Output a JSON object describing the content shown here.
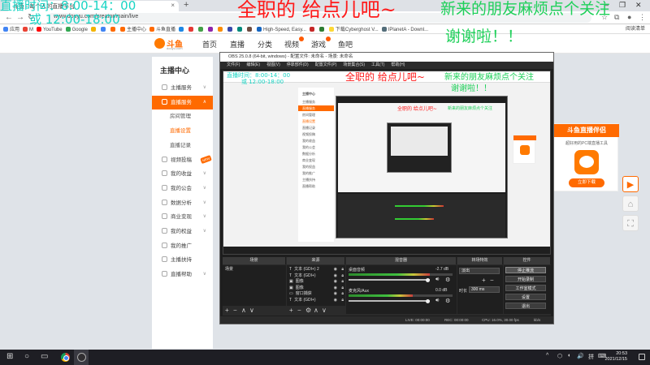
{
  "browser": {
    "tab_title": "斗鱼 - 每个人的直播平台",
    "new_tab": "+",
    "window_controls": [
      "–",
      "❐",
      "✕"
    ],
    "url": "www.douyu.com/creator/main/live",
    "bookmarks": [
      {
        "label": "应用",
        "color": "#4285f4"
      },
      {
        "label": "M",
        "color": "#ea4335"
      },
      {
        "label": "YouTube",
        "color": "#ff0000"
      },
      {
        "label": "Google",
        "color": "#34a853"
      },
      {
        "label": "",
        "color": "#f4b400"
      },
      {
        "label": "",
        "color": "#4285f4"
      },
      {
        "label": "",
        "color": "#ff6a00"
      },
      {
        "label": "主播中心",
        "color": "#ff6a00"
      },
      {
        "label": "斗鱼直播",
        "color": "#ff6a00"
      },
      {
        "label": "",
        "color": "#1e88e5"
      },
      {
        "label": "",
        "color": "#e53935"
      },
      {
        "label": "",
        "color": "#43a047"
      },
      {
        "label": "",
        "color": "#8e24aa"
      },
      {
        "label": "",
        "color": "#fb8c00"
      },
      {
        "label": "",
        "color": "#3949ab"
      },
      {
        "label": "",
        "color": "#00897b"
      },
      {
        "label": "",
        "color": "#6d4c41"
      },
      {
        "label": "High-Speed, Easy...",
        "color": "#1565c0"
      },
      {
        "label": "",
        "color": "#c62828"
      },
      {
        "label": "",
        "color": "#2e7d32"
      },
      {
        "label": "下载Cyberghost V...",
        "color": "#fdd835"
      },
      {
        "label": "IPlanetA - Downl...",
        "color": "#546e7a"
      }
    ],
    "bookmarks_right": "阅读清单"
  },
  "site": {
    "logo_text": "斗鱼",
    "logo_sub": "douyu.com",
    "nav": [
      "首页",
      "直播",
      "分类",
      "视频",
      "游戏",
      "鱼吧"
    ],
    "hot_dot_color": "#ff5a00",
    "accent": "#ff6a00"
  },
  "sidebar": {
    "title": "主播中心",
    "items": [
      {
        "label": "主播服务",
        "arrow": "∨"
      },
      {
        "label": "直播服务",
        "arrow": "∧",
        "active": true
      },
      {
        "label": "房间管理",
        "sub": true
      },
      {
        "label": "直播设置",
        "sub": true,
        "active": true
      },
      {
        "label": "直播记录",
        "sub": true
      },
      {
        "label": "视频投稿",
        "arrow": "",
        "badge": "NEW"
      },
      {
        "label": "我的收益",
        "arrow": "∨"
      },
      {
        "label": "我的公会",
        "arrow": "∨"
      },
      {
        "label": "数据分析",
        "arrow": "∨"
      },
      {
        "label": "商业变现",
        "arrow": "∨"
      },
      {
        "label": "我的权益",
        "arrow": "∨"
      },
      {
        "label": "我的推广",
        "arrow": ""
      },
      {
        "label": "主播扶持",
        "arrow": ""
      },
      {
        "label": "直播帮助",
        "arrow": "∨"
      }
    ]
  },
  "ad": {
    "title": "斗鱼直播伴侣",
    "text": "超好用的PC端直播工具",
    "button": "立即下载"
  },
  "float_buttons": [
    "▶",
    "⌂",
    "⛶"
  ],
  "obs": {
    "title": "OBS 25.0.8 (64-bit, windows) - 配置文件: 未命名 - 场景: 未命名",
    "menu": [
      "文件(F)",
      "编辑(E)",
      "视图(V)",
      "停靠部件(D)",
      "配置文件(P)",
      "场景集合(S)",
      "工具(T)",
      "帮助(H)"
    ],
    "docks": {
      "scenes": "场景",
      "sources": "来源",
      "mixer": "混音器",
      "transitions": "转场特效",
      "controls": "控件"
    },
    "scene_items": [
      "场景"
    ],
    "sources": [
      "文本 (GDI+) 2",
      "文本 (GDI+)",
      "图像",
      "图像",
      "窗口捕获",
      "文本 (GDI+)"
    ],
    "source_icons": [
      "T",
      "T",
      "▣",
      "▣",
      "▭",
      "T"
    ],
    "mixer": [
      {
        "name": "桌面音频",
        "db": "-2.7 dB",
        "level": 0.78
      },
      {
        "name": "麦克风/Aux",
        "db": "0.0 dB",
        "level": 0.62
      }
    ],
    "transition": "淡出",
    "duration_label": "时长",
    "duration": "300 ms",
    "controls": [
      "停止推流",
      "开始录制",
      "工作室模式",
      "设置",
      "退出"
    ],
    "status": {
      "live": "LIVE: 00:00:00",
      "rec": "REC: 00:00:00",
      "cpu": "CPU: 16.0%, 30.00 fps",
      "kbps": "kb/s"
    },
    "dock_buttons": [
      "+",
      "−",
      "∧",
      "∨",
      "⚙"
    ]
  },
  "overlays": {
    "time_line1": "直播时间：8:00-14：00",
    "time_line2": "或 12:00-18:00",
    "red_text": "全职的 给点儿吧~",
    "green_text1": "新来的朋友麻烦点个关注",
    "green_text2": "谢谢啦！！"
  },
  "taskbar": {
    "start": "⊞",
    "search": "○",
    "taskview": "▭",
    "tray": [
      "^",
      "⬡",
      "◖",
      "🔊",
      "拼",
      "⌨"
    ],
    "time": "20:53",
    "date": "2021/12/15"
  }
}
